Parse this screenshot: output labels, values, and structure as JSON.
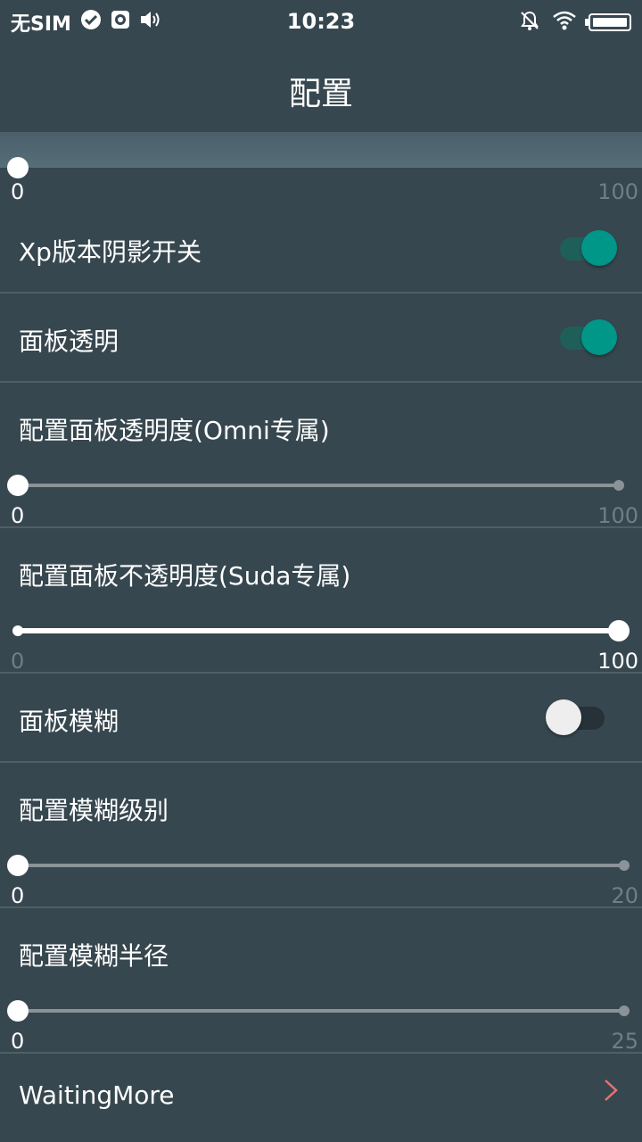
{
  "status_bar": {
    "carrier": "无SIM",
    "time": "10:23"
  },
  "app_bar": {
    "title": "配置"
  },
  "partial_slider": {
    "min_label": "0",
    "max_label": "100"
  },
  "settings": {
    "xp_shadow": {
      "label": "Xp版本阴影开关",
      "on": true
    },
    "panel_transparent": {
      "label": "面板透明",
      "on": true
    },
    "omni_transparency": {
      "label": "配置面板透明度(Omni专属)",
      "min_label": "0",
      "max_label": "100",
      "value": 0
    },
    "suda_opacity": {
      "label": "配置面板不透明度(Suda专属)",
      "min_label": "0",
      "max_label": "100",
      "value": 100
    },
    "panel_blur": {
      "label": "面板模糊",
      "on": false
    },
    "blur_level": {
      "label": "配置模糊级别",
      "min_label": "0",
      "max_label": "20",
      "value": 0
    },
    "blur_radius": {
      "label": "配置模糊半径",
      "min_label": "0",
      "max_label": "25",
      "value": 0
    },
    "waiting_more": {
      "label": "WaitingMore"
    }
  },
  "colors": {
    "background": "#37474f",
    "switch_on": "#009688",
    "switch_on_track": "#1f5f5a",
    "switch_off_thumb": "#eeeeee",
    "switch_off_track": "#263238",
    "chevron": "#e57373"
  }
}
